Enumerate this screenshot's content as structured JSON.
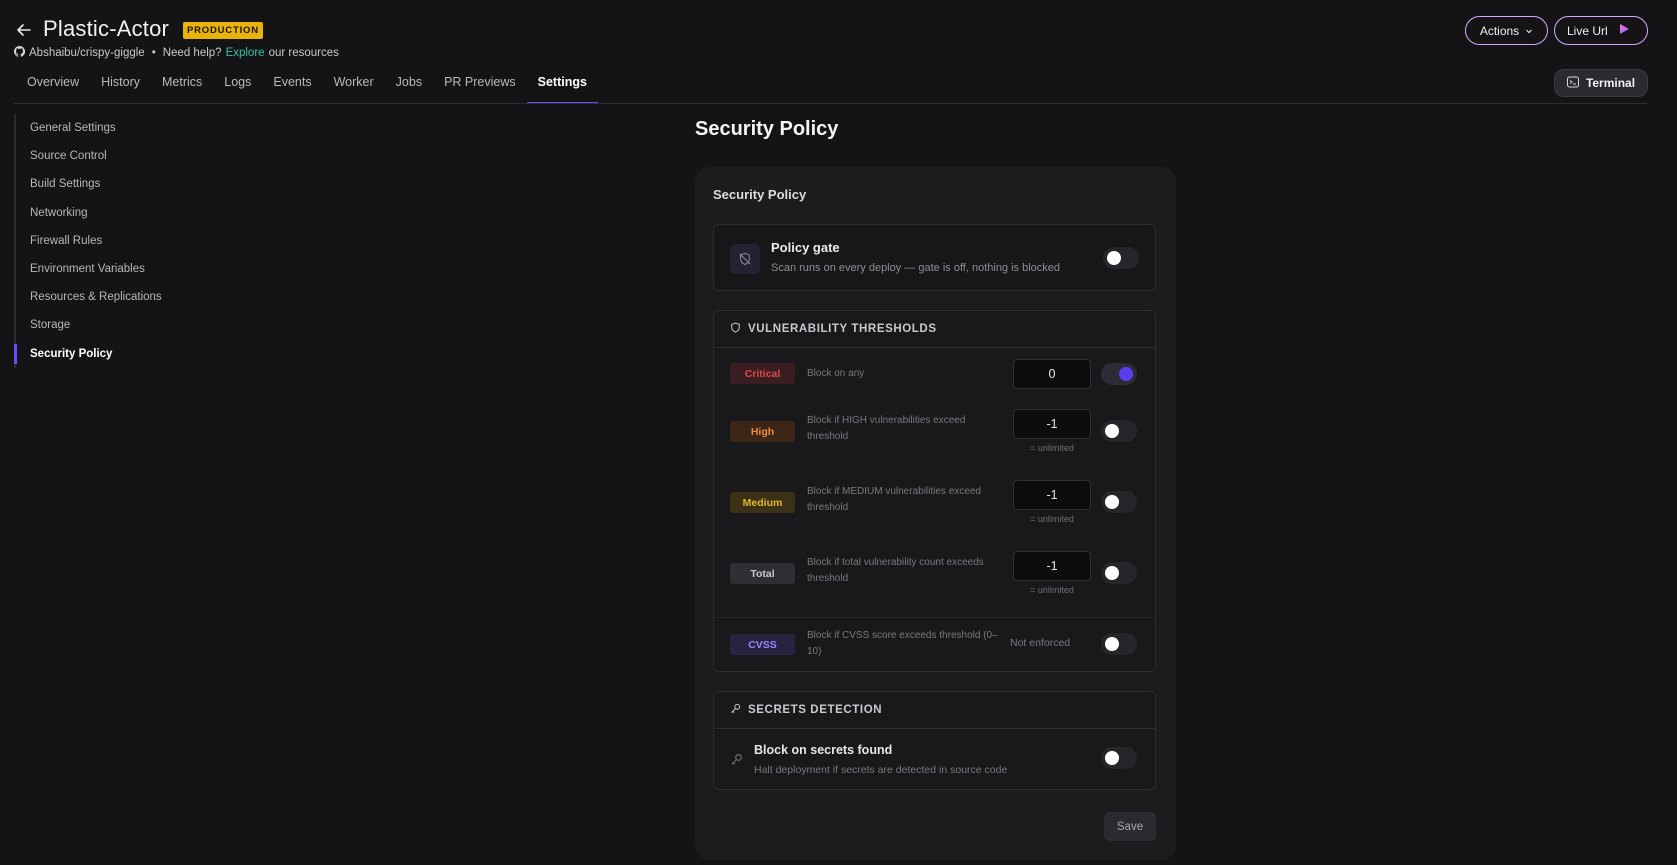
{
  "header": {
    "title": "Plastic-Actor",
    "env_badge": "PRODUCTION",
    "repo": "Abshaibu/crispy-giggle",
    "help_prefix": "Need help?",
    "help_link": "Explore",
    "help_suffix": "our resources",
    "actions_label": "Actions",
    "live_url_label": "Live Url",
    "terminal_label": "Terminal"
  },
  "tabs": [
    {
      "label": "Overview"
    },
    {
      "label": "History"
    },
    {
      "label": "Metrics"
    },
    {
      "label": "Logs"
    },
    {
      "label": "Events"
    },
    {
      "label": "Worker"
    },
    {
      "label": "Jobs"
    },
    {
      "label": "PR Previews"
    },
    {
      "label": "Settings",
      "active": true
    }
  ],
  "sidebar": {
    "items": [
      {
        "label": "General Settings"
      },
      {
        "label": "Source Control"
      },
      {
        "label": "Build Settings"
      },
      {
        "label": "Networking"
      },
      {
        "label": "Firewall Rules"
      },
      {
        "label": "Environment Variables"
      },
      {
        "label": "Resources & Replications"
      },
      {
        "label": "Storage"
      },
      {
        "label": "Security Policy",
        "active": true
      }
    ]
  },
  "main": {
    "page_title": "Security Policy",
    "card_title": "Security Policy",
    "gate": {
      "title": "Policy gate",
      "description": "Scan runs on every deploy — gate is off, nothing is blocked",
      "enabled": false
    },
    "vulnerability": {
      "heading": "VULNERABILITY THRESHOLDS",
      "rows": [
        {
          "severity": "Critical",
          "description": "Block on any",
          "value": "0",
          "hint": "",
          "enabled": true
        },
        {
          "severity": "High",
          "description": "Block if HIGH vulnerabilities exceed threshold",
          "value": "-1",
          "hint": "= unlimited",
          "enabled": false
        },
        {
          "severity": "Medium",
          "description": "Block if MEDIUM vulnerabilities exceed threshold",
          "value": "-1",
          "hint": "= unlimited",
          "enabled": false
        },
        {
          "severity": "Total",
          "description": "Block if total vulnerability count exceeds threshold",
          "value": "-1",
          "hint": "= unlimited",
          "enabled": false
        },
        {
          "severity": "CVSS",
          "description": "Block if CVSS score exceeds threshold (0–10)",
          "status": "Not enforced",
          "enabled": false
        }
      ]
    },
    "secrets": {
      "heading": "SECRETS DETECTION",
      "title": "Block on secrets found",
      "description": "Halt deployment if secrets are detected in source code",
      "enabled": false
    },
    "save_label": "Save"
  },
  "colors": {
    "accent": "#6a4cff",
    "badge": "#e8b40c",
    "link": "#34c3a8",
    "critical": "#e0484e",
    "high": "#f08a3a",
    "medium": "#e7b62a",
    "cvss": "#9a86ff"
  }
}
